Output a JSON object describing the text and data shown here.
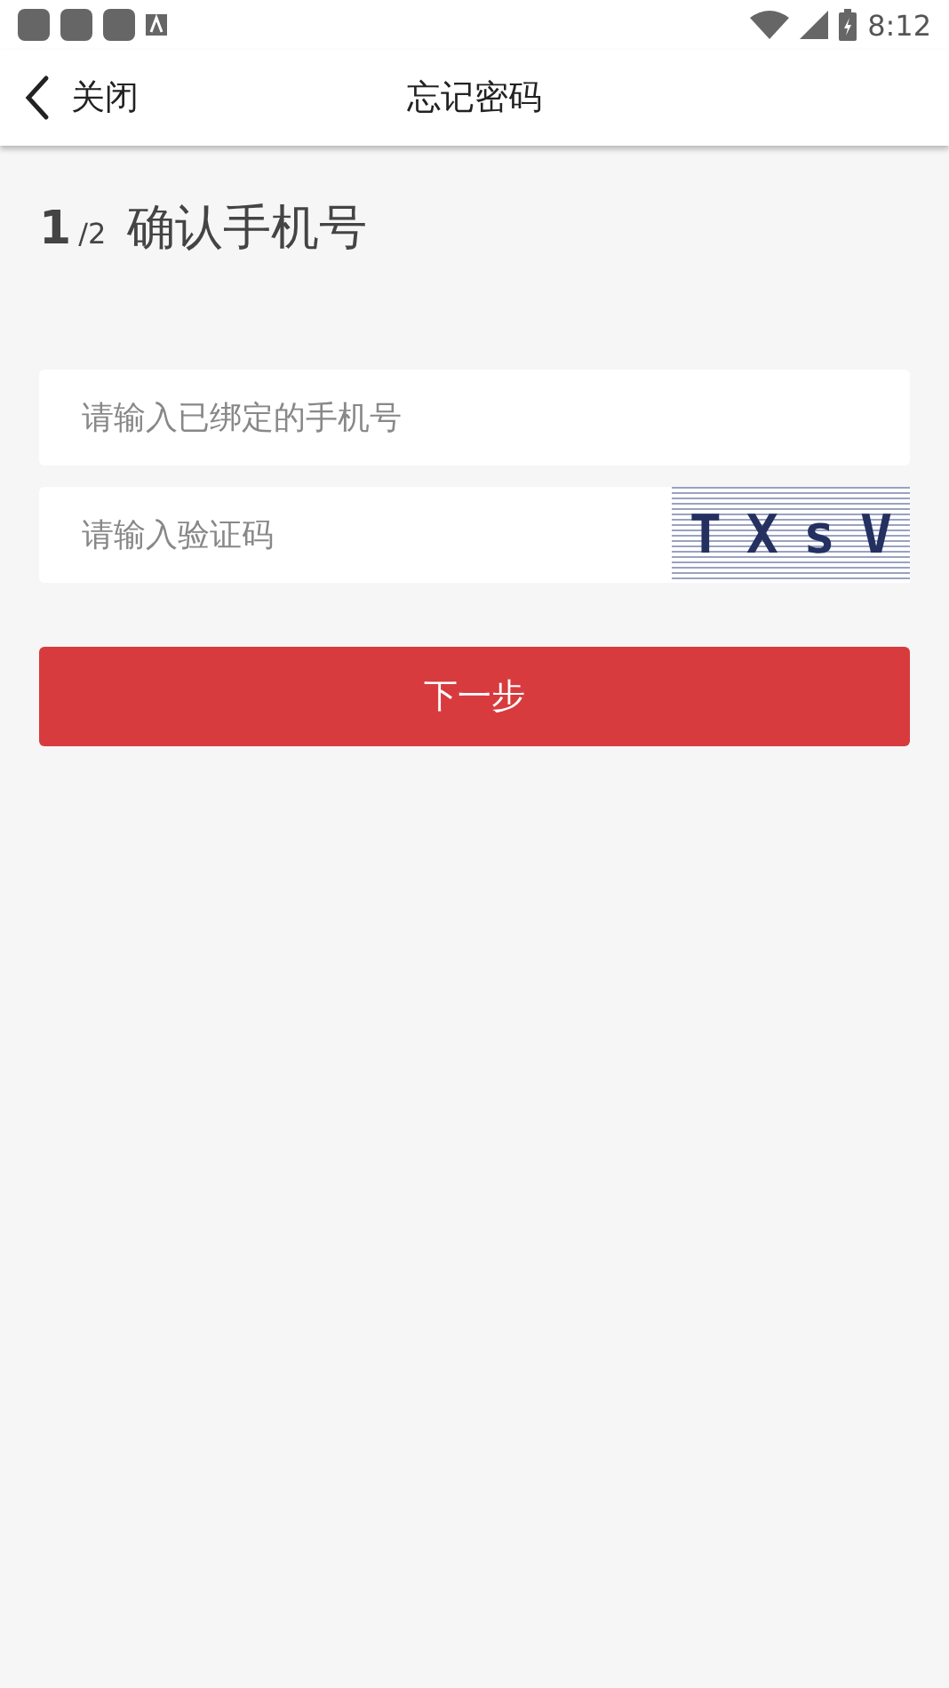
{
  "status_bar": {
    "time": "8:12"
  },
  "header": {
    "back_label": "关闭",
    "title": "忘记密码"
  },
  "step": {
    "current": "1",
    "total": "/2",
    "title": "确认手机号"
  },
  "phone_field": {
    "placeholder": "请输入已绑定的手机号"
  },
  "code_field": {
    "placeholder": "请输入验证码",
    "captcha": "TXsV"
  },
  "next_button": {
    "label": "下一步"
  }
}
